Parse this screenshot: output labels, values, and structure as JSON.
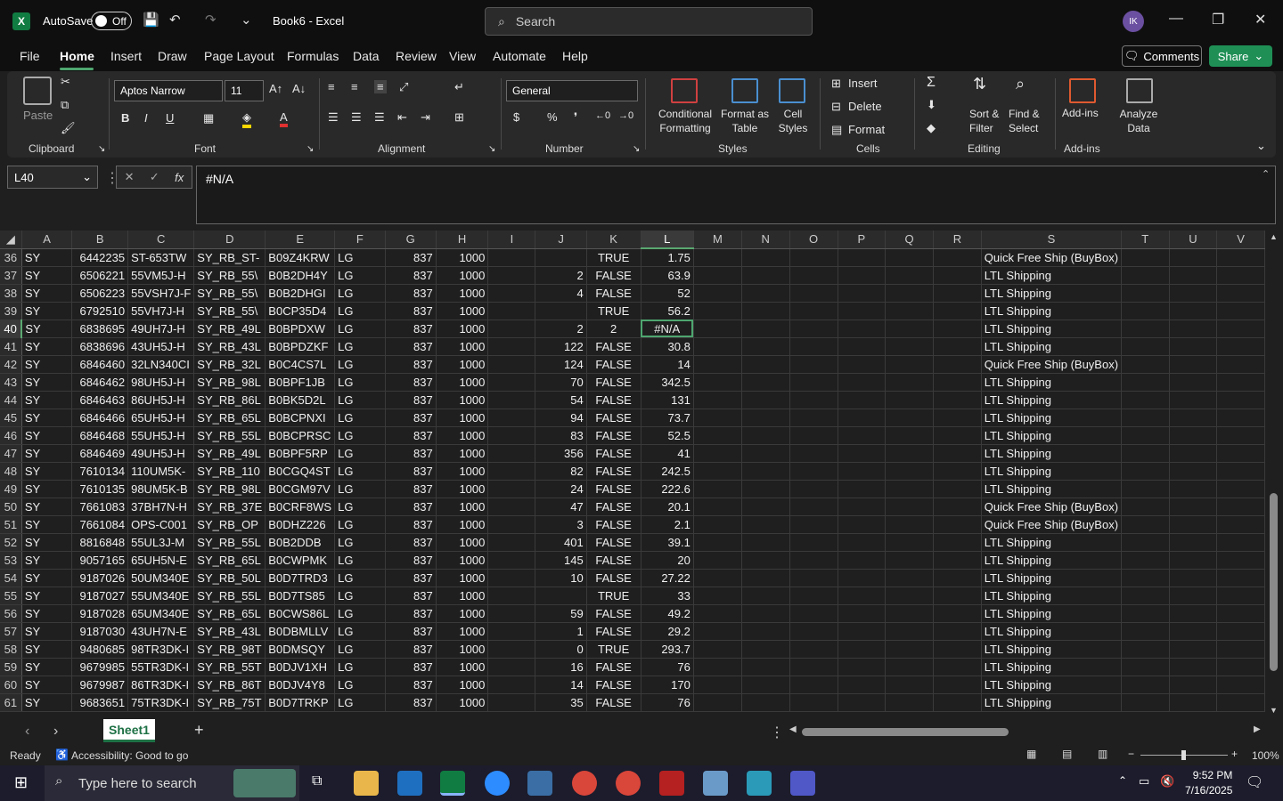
{
  "title": {
    "autosave_label": "AutoSave",
    "autosave_state": "Off",
    "document": "Book6 - Excel",
    "search_placeholder": "Search",
    "user_initials": "IK"
  },
  "menu": [
    "File",
    "Home",
    "Insert",
    "Draw",
    "Page Layout",
    "Formulas",
    "Data",
    "Review",
    "View",
    "Automate",
    "Help"
  ],
  "menu_active": "Home",
  "actions": {
    "comments": "Comments",
    "share": "Share"
  },
  "ribbon": {
    "groups": {
      "clipboard": "Clipboard",
      "font": "Font",
      "alignment": "Alignment",
      "number": "Number",
      "styles": "Styles",
      "cells": "Cells",
      "editing": "Editing",
      "addins": "Add-ins"
    },
    "paste": "Paste",
    "font_name": "Aptos Narrow",
    "font_size": "11",
    "number_format": "General",
    "conditional_formatting": "Conditional\nFormatting",
    "format_as_table": "Format as\nTable",
    "cell_styles": "Cell\nStyles",
    "insert": "Insert",
    "delete": "Delete",
    "format": "Format",
    "sort_filter": "Sort &\nFilter",
    "find_select": "Find &\nSelect",
    "addins_btn": "Add-ins",
    "analyze": "Analyze\nData"
  },
  "formula_bar": {
    "name_box": "L40",
    "formula": "#N/A"
  },
  "columns": [
    "A",
    "B",
    "C",
    "D",
    "E",
    "F",
    "G",
    "H",
    "I",
    "J",
    "K",
    "L",
    "M",
    "N",
    "O",
    "P",
    "Q",
    "R",
    "S",
    "T",
    "U",
    "V"
  ],
  "selected_column": "L",
  "selected_row": "40",
  "rows": [
    {
      "n": "36",
      "A": "SY",
      "B": "6442235",
      "C": "ST-653TW",
      "D": "SY_RB_ST-",
      "E": "B09Z4KRW",
      "F": "LG",
      "G": "837",
      "H": "1000",
      "J": "",
      "K": "TRUE",
      "L": "1.75",
      "S": "Quick Free Ship (BuyBox)"
    },
    {
      "n": "37",
      "A": "SY",
      "B": "6506221",
      "C": "55VM5J-H",
      "D": "SY_RB_55\\",
      "E": "B0B2DH4Y",
      "F": "LG",
      "G": "837",
      "H": "1000",
      "J": "2",
      "K": "FALSE",
      "L": "63.9",
      "S": "LTL Shipping"
    },
    {
      "n": "38",
      "A": "SY",
      "B": "6506223",
      "C": "55VSH7J-F",
      "D": "SY_RB_55\\",
      "E": "B0B2DHGI",
      "F": "LG",
      "G": "837",
      "H": "1000",
      "J": "4",
      "K": "FALSE",
      "L": "52",
      "S": "LTL Shipping"
    },
    {
      "n": "39",
      "A": "SY",
      "B": "6792510",
      "C": "55VH7J-H",
      "D": "SY_RB_55\\",
      "E": "B0CP35D4",
      "F": "LG",
      "G": "837",
      "H": "1000",
      "J": "",
      "K": "TRUE",
      "L": "56.2",
      "S": "LTL Shipping"
    },
    {
      "n": "40",
      "A": "SY",
      "B": "6838695",
      "C": "49UH7J-H",
      "D": "SY_RB_49L",
      "E": "B0BPDXW",
      "F": "LG",
      "G": "837",
      "H": "1000",
      "J": "2",
      "K": "2",
      "L": "#N/A",
      "S": "LTL Shipping"
    },
    {
      "n": "41",
      "A": "SY",
      "B": "6838696",
      "C": "43UH5J-H",
      "D": "SY_RB_43L",
      "E": "B0BPDZKF",
      "F": "LG",
      "G": "837",
      "H": "1000",
      "J": "122",
      "K": "FALSE",
      "L": "30.8",
      "S": "LTL Shipping"
    },
    {
      "n": "42",
      "A": "SY",
      "B": "6846460",
      "C": "32LN340CI",
      "D": "SY_RB_32L",
      "E": "B0C4CS7L",
      "F": "LG",
      "G": "837",
      "H": "1000",
      "J": "124",
      "K": "FALSE",
      "L": "14",
      "S": "Quick Free Ship (BuyBox)"
    },
    {
      "n": "43",
      "A": "SY",
      "B": "6846462",
      "C": "98UH5J-H",
      "D": "SY_RB_98L",
      "E": "B0BPF1JB",
      "F": "LG",
      "G": "837",
      "H": "1000",
      "J": "70",
      "K": "FALSE",
      "L": "342.5",
      "S": "LTL Shipping"
    },
    {
      "n": "44",
      "A": "SY",
      "B": "6846463",
      "C": "86UH5J-H",
      "D": "SY_RB_86L",
      "E": "B0BK5D2L",
      "F": "LG",
      "G": "837",
      "H": "1000",
      "J": "54",
      "K": "FALSE",
      "L": "131",
      "S": "LTL Shipping"
    },
    {
      "n": "45",
      "A": "SY",
      "B": "6846466",
      "C": "65UH5J-H",
      "D": "SY_RB_65L",
      "E": "B0BCPNXI",
      "F": "LG",
      "G": "837",
      "H": "1000",
      "J": "94",
      "K": "FALSE",
      "L": "73.7",
      "S": "LTL Shipping"
    },
    {
      "n": "46",
      "A": "SY",
      "B": "6846468",
      "C": "55UH5J-H",
      "D": "SY_RB_55L",
      "E": "B0BCPRSC",
      "F": "LG",
      "G": "837",
      "H": "1000",
      "J": "83",
      "K": "FALSE",
      "L": "52.5",
      "S": "LTL Shipping"
    },
    {
      "n": "47",
      "A": "SY",
      "B": "6846469",
      "C": "49UH5J-H",
      "D": "SY_RB_49L",
      "E": "B0BPF5RP",
      "F": "LG",
      "G": "837",
      "H": "1000",
      "J": "356",
      "K": "FALSE",
      "L": "41",
      "S": "LTL Shipping"
    },
    {
      "n": "48",
      "A": "SY",
      "B": "7610134",
      "C": "110UM5K-",
      "D": "SY_RB_110",
      "E": "B0CGQ4ST",
      "F": "LG",
      "G": "837",
      "H": "1000",
      "J": "82",
      "K": "FALSE",
      "L": "242.5",
      "S": "LTL Shipping"
    },
    {
      "n": "49",
      "A": "SY",
      "B": "7610135",
      "C": "98UM5K-B",
      "D": "SY_RB_98L",
      "E": "B0CGM97V",
      "F": "LG",
      "G": "837",
      "H": "1000",
      "J": "24",
      "K": "FALSE",
      "L": "222.6",
      "S": "LTL Shipping"
    },
    {
      "n": "50",
      "A": "SY",
      "B": "7661083",
      "C": "37BH7N-H",
      "D": "SY_RB_37E",
      "E": "B0CRF8WS",
      "F": "LG",
      "G": "837",
      "H": "1000",
      "J": "47",
      "K": "FALSE",
      "L": "20.1",
      "S": "Quick Free Ship (BuyBox)"
    },
    {
      "n": "51",
      "A": "SY",
      "B": "7661084",
      "C": "OPS-C001",
      "D": "SY_RB_OP",
      "E": "B0DHZ226",
      "F": "LG",
      "G": "837",
      "H": "1000",
      "J": "3",
      "K": "FALSE",
      "L": "2.1",
      "S": "Quick Free Ship (BuyBox)"
    },
    {
      "n": "52",
      "A": "SY",
      "B": "8816848",
      "C": "55UL3J-M",
      "D": "SY_RB_55L",
      "E": "B0B2DDB",
      "F": "LG",
      "G": "837",
      "H": "1000",
      "J": "401",
      "K": "FALSE",
      "L": "39.1",
      "S": "LTL Shipping"
    },
    {
      "n": "53",
      "A": "SY",
      "B": "9057165",
      "C": "65UH5N-E",
      "D": "SY_RB_65L",
      "E": "B0CWPMK",
      "F": "LG",
      "G": "837",
      "H": "1000",
      "J": "145",
      "K": "FALSE",
      "L": "20",
      "S": "LTL Shipping"
    },
    {
      "n": "54",
      "A": "SY",
      "B": "9187026",
      "C": "50UM340E",
      "D": "SY_RB_50L",
      "E": "B0D7TRD3",
      "F": "LG",
      "G": "837",
      "H": "1000",
      "J": "10",
      "K": "FALSE",
      "L": "27.22",
      "S": "LTL Shipping"
    },
    {
      "n": "55",
      "A": "SY",
      "B": "9187027",
      "C": "55UM340E",
      "D": "SY_RB_55L",
      "E": "B0D7TS85",
      "F": "LG",
      "G": "837",
      "H": "1000",
      "J": "",
      "K": "TRUE",
      "L": "33",
      "S": "LTL Shipping"
    },
    {
      "n": "56",
      "A": "SY",
      "B": "9187028",
      "C": "65UM340E",
      "D": "SY_RB_65L",
      "E": "B0CWS86L",
      "F": "LG",
      "G": "837",
      "H": "1000",
      "J": "59",
      "K": "FALSE",
      "L": "49.2",
      "S": "LTL Shipping"
    },
    {
      "n": "57",
      "A": "SY",
      "B": "9187030",
      "C": "43UH7N-E",
      "D": "SY_RB_43L",
      "E": "B0DBMLLV",
      "F": "LG",
      "G": "837",
      "H": "1000",
      "J": "1",
      "K": "FALSE",
      "L": "29.2",
      "S": "LTL Shipping"
    },
    {
      "n": "58",
      "A": "SY",
      "B": "9480685",
      "C": "98TR3DK-I",
      "D": "SY_RB_98T",
      "E": "B0DMSQY",
      "F": "LG",
      "G": "837",
      "H": "1000",
      "J": "0",
      "K": "TRUE",
      "L": "293.7",
      "S": "LTL Shipping"
    },
    {
      "n": "59",
      "A": "SY",
      "B": "9679985",
      "C": "55TR3DK-I",
      "D": "SY_RB_55T",
      "E": "B0DJV1XH",
      "F": "LG",
      "G": "837",
      "H": "1000",
      "J": "16",
      "K": "FALSE",
      "L": "76",
      "S": "LTL Shipping"
    },
    {
      "n": "60",
      "A": "SY",
      "B": "9679987",
      "C": "86TR3DK-I",
      "D": "SY_RB_86T",
      "E": "B0DJV4Y8",
      "F": "LG",
      "G": "837",
      "H": "1000",
      "J": "14",
      "K": "FALSE",
      "L": "170",
      "S": "LTL Shipping"
    },
    {
      "n": "61",
      "A": "SY",
      "B": "9683651",
      "C": "75TR3DK-I",
      "D": "SY_RB_75T",
      "E": "B0D7TRKP",
      "F": "LG",
      "G": "837",
      "H": "1000",
      "J": "35",
      "K": "FALSE",
      "L": "76",
      "S": "LTL Shipping"
    }
  ],
  "sheet_tab": "Sheet1",
  "status": {
    "ready": "Ready",
    "accessibility": "Accessibility: Good to go",
    "zoom": "100%"
  },
  "taskbar": {
    "search_placeholder": "Type here to search",
    "time": "9:52 PM",
    "date": "7/16/2025"
  }
}
